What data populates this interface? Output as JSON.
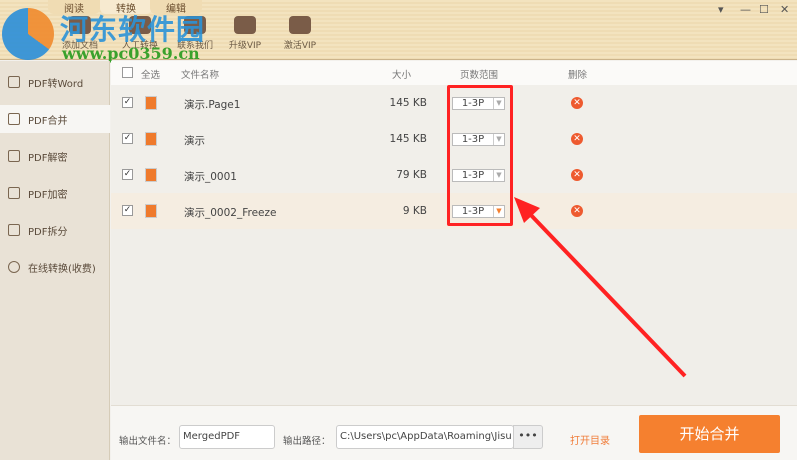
{
  "header": {
    "tabs": [
      "阅读",
      "转换",
      "编辑"
    ],
    "tools": [
      {
        "label": "添加文档",
        "icon": "add-document-icon"
      },
      {
        "label": "人工转换",
        "icon": "manual-convert-icon"
      },
      {
        "label": "联系我们",
        "icon": "contact-icon"
      },
      {
        "label": "升级VIP",
        "icon": "crown-icon"
      },
      {
        "label": "激活VIP",
        "icon": "activate-vip-icon"
      }
    ],
    "window_controls": [
      "▾",
      "—",
      "☐",
      "✕"
    ],
    "watermark": {
      "title": "河东软件园",
      "url": "www.pc0359.cn"
    }
  },
  "sidebar": {
    "items": [
      {
        "label": "PDF转Word",
        "active": false
      },
      {
        "label": "PDF合并",
        "active": true
      },
      {
        "label": "PDF解密",
        "active": false
      },
      {
        "label": "PDF加密",
        "active": false
      },
      {
        "label": "PDF拆分",
        "active": false
      },
      {
        "label": "在线转换(收费)",
        "active": false
      }
    ]
  },
  "table": {
    "headers": {
      "select_all": "全选",
      "name": "文件名称",
      "size": "大小",
      "range": "页数范围",
      "delete": "删除"
    },
    "rows": [
      {
        "name": "演示.Page1",
        "size": "145 KB",
        "range": "1-3P",
        "checked": true
      },
      {
        "name": "演示",
        "size": "145 KB",
        "range": "1-3P",
        "checked": true
      },
      {
        "name": "演示_0001",
        "size": "79 KB",
        "range": "1-3P",
        "checked": true
      },
      {
        "name": "演示_0002_Freeze",
        "size": "9 KB",
        "range": "1-3P",
        "checked": true
      }
    ]
  },
  "bottom": {
    "filename_label": "输出文件名：",
    "filename_value": "MergedPDF",
    "path_label": "输出路径：",
    "path_value": "C:\\Users\\pc\\AppData\\Roaming\\Jisu",
    "browse": "•••",
    "open_dir": "打开目录",
    "start": "开始合并"
  },
  "colors": {
    "accent": "#f5802f",
    "annotation": "#ff2222"
  }
}
